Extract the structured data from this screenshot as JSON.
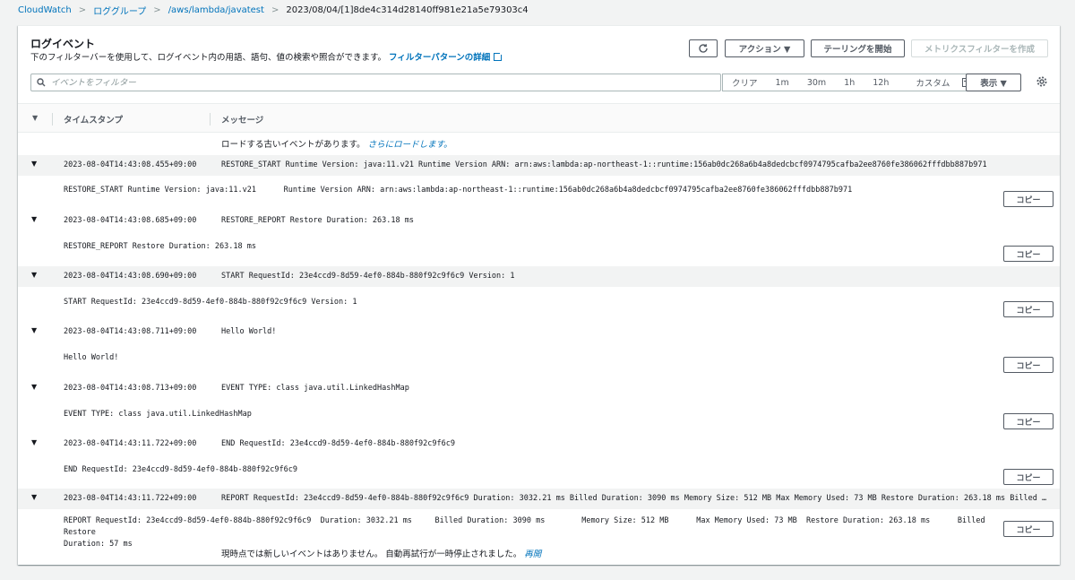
{
  "breadcrumb": [
    "CloudWatch",
    "ロググループ",
    "/aws/lambda/javatest",
    "2023/08/04/[1]8de4c314d28140ff981e21a5e79303c4"
  ],
  "header": {
    "title": "ログイベント",
    "description": "下のフィルターバーを使用して、ログイベント内の用語、語句、値の検索や照合ができます。",
    "link": "フィルターパターンの詳細"
  },
  "buttons": {
    "actions": "アクション ▼",
    "tail": "テーリングを開始",
    "metric_filter": "メトリクスフィルターを作成",
    "display": "表示 ▼"
  },
  "search": {
    "placeholder": "イベントをフィルター"
  },
  "timerange": {
    "clear": "クリア",
    "t1": "1m",
    "t2": "30m",
    "t3": "1h",
    "t4": "12h",
    "custom": "カスタム"
  },
  "table": {
    "col_timestamp": "タイムスタンプ",
    "col_message": "メッセージ"
  },
  "load_older": {
    "text": "ロードする古いイベントがあります。",
    "link": "さらにロードします。"
  },
  "copy_label": "コピー",
  "events": [
    {
      "timestamp": "2023-08-04T14:43:08.455+09:00",
      "message": "RESTORE_START Runtime Version: java:11.v21 Runtime Version ARN: arn:aws:lambda:ap-northeast-1::runtime:156ab0dc268a6b4a8dedcbcf0974795cafba2ee8760fe386062fffdbb887b971",
      "body": "RESTORE_START Runtime Version: java:11.v21      Runtime Version ARN: arn:aws:lambda:ap-northeast-1::runtime:156ab0dc268a6b4a8dedcbcf0974795cafba2ee8760fe386062fffdbb887b971"
    },
    {
      "timestamp": "2023-08-04T14:43:08.685+09:00",
      "message": "RESTORE_REPORT Restore Duration: 263.18 ms",
      "body": "RESTORE_REPORT Restore Duration: 263.18 ms"
    },
    {
      "timestamp": "2023-08-04T14:43:08.690+09:00",
      "message": "START RequestId: 23e4ccd9-8d59-4ef0-884b-880f92c9f6c9 Version: 1",
      "body": "START RequestId: 23e4ccd9-8d59-4ef0-884b-880f92c9f6c9 Version: 1"
    },
    {
      "timestamp": "2023-08-04T14:43:08.711+09:00",
      "message": "Hello World!",
      "body": "Hello World!"
    },
    {
      "timestamp": "2023-08-04T14:43:08.713+09:00",
      "message": "EVENT TYPE: class java.util.LinkedHashMap",
      "body": "EVENT TYPE: class java.util.LinkedHashMap"
    },
    {
      "timestamp": "2023-08-04T14:43:11.722+09:00",
      "message": "END RequestId: 23e4ccd9-8d59-4ef0-884b-880f92c9f6c9",
      "body": "END RequestId: 23e4ccd9-8d59-4ef0-884b-880f92c9f6c9"
    },
    {
      "timestamp": "2023-08-04T14:43:11.722+09:00",
      "message": "REPORT RequestId: 23e4ccd9-8d59-4ef0-884b-880f92c9f6c9 Duration: 3032.21 ms Billed Duration: 3090 ms Memory Size: 512 MB Max Memory Used: 73 MB Restore Duration: 263.18 ms Billed Restore D…",
      "body": "REPORT RequestId: 23e4ccd9-8d59-4ef0-884b-880f92c9f6c9  Duration: 3032.21 ms     Billed Duration: 3090 ms        Memory Size: 512 MB      Max Memory Used: 73 MB  Restore Duration: 263.18 ms      Billed Restore\nDuration: 57 ms"
    }
  ],
  "no_new": {
    "text": "現時点では新しいイベントはありません。 自動再試行が一時停止されました。",
    "link": "再開"
  }
}
